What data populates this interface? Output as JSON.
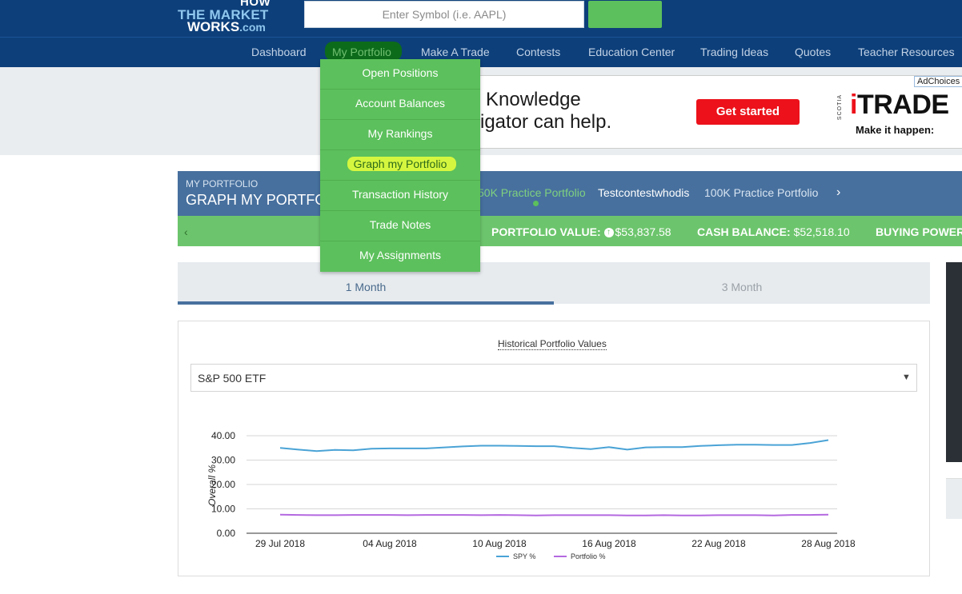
{
  "header": {
    "logo_line1": "HOW",
    "logo_line2": "THE MARKET",
    "logo_line3": "WORKS",
    "logo_line3_suffix": ".com",
    "search_placeholder": "Enter Symbol (i.e. AAPL)",
    "go_label": ""
  },
  "nav": {
    "items": [
      "Dashboard",
      "My Portfolio",
      "Make A Trade",
      "Contests",
      "Education Center",
      "Trading Ideas",
      "Quotes",
      "Teacher Resources"
    ]
  },
  "dropdown": {
    "items": [
      "Open Positions",
      "Account Balances",
      "My Rankings",
      "Graph my Portfolio",
      "Transaction History",
      "Trade Notes",
      "My Assignments"
    ]
  },
  "ad": {
    "line1": "Knowledge",
    "line2": "igator can help.",
    "cta": "Get started",
    "adchoices": "AdChoices",
    "brand_i": "i",
    "brand_rest": "TRADE",
    "brand_vertical": "SCOTIA",
    "tagline": "Make it happen:"
  },
  "portfolio": {
    "kicker": "MY PORTFOLIO",
    "title": "GRAPH MY PORTFOLIO",
    "tabs": [
      "50K Practice Portfolio",
      "Testcontestwhodis",
      "100K Practice Portfolio"
    ],
    "next_icon": "chevron-right-icon",
    "prev_icon": "chevron-left-icon"
  },
  "stats": {
    "portfolio_value_label": "PORTFOLIO VALUE:",
    "portfolio_value": "$53,837.58",
    "cash_balance_label": "CASH BALANCE:",
    "cash_balance": "$52,518.10",
    "buying_power_label": "BUYING POWER:"
  },
  "range_tabs": {
    "one_month": "1 Month",
    "three_month": "3 Month"
  },
  "chart_panel": {
    "title": "Historical Portfolio Values",
    "compare_selected": "S&P 500 ETF"
  },
  "colors": {
    "header_navy": "#0d3f7a",
    "accent_green": "#5cc05c",
    "portfolio_blue": "#47709e",
    "spy_line": "#4aa3d6",
    "portfolio_line": "#b469e0"
  },
  "chart_data": {
    "type": "line",
    "title": "",
    "xlabel": "",
    "ylabel": "Overall %",
    "ylim": [
      0,
      40
    ],
    "yticks": [
      "40.00",
      "30.00",
      "20.00",
      "10.00",
      "0.00"
    ],
    "x_tick_labels": [
      "29 Jul 2018",
      "04 Aug 2018",
      "10 Aug 2018",
      "16 Aug 2018",
      "22 Aug 2018",
      "28 Aug 2018"
    ],
    "x": [
      "29 Jul 2018",
      "30 Jul 2018",
      "31 Jul 2018",
      "01 Aug 2018",
      "02 Aug 2018",
      "03 Aug 2018",
      "04 Aug 2018",
      "05 Aug 2018",
      "06 Aug 2018",
      "07 Aug 2018",
      "08 Aug 2018",
      "09 Aug 2018",
      "10 Aug 2018",
      "11 Aug 2018",
      "12 Aug 2018",
      "13 Aug 2018",
      "14 Aug 2018",
      "15 Aug 2018",
      "16 Aug 2018",
      "17 Aug 2018",
      "18 Aug 2018",
      "19 Aug 2018",
      "20 Aug 2018",
      "21 Aug 2018",
      "22 Aug 2018",
      "23 Aug 2018",
      "24 Aug 2018",
      "25 Aug 2018",
      "26 Aug 2018",
      "27 Aug 2018",
      "28 Aug 2018"
    ],
    "series": [
      {
        "name": "SPY %",
        "color": "#4aa3d6",
        "values": [
          35.0,
          34.3,
          33.7,
          34.2,
          34.0,
          34.7,
          34.8,
          34.8,
          34.8,
          35.2,
          35.6,
          35.9,
          35.9,
          35.8,
          35.7,
          35.7,
          35.0,
          34.5,
          35.3,
          34.3,
          35.2,
          35.3,
          35.3,
          35.8,
          36.1,
          36.3,
          36.3,
          36.2,
          36.2,
          37.0,
          38.2
        ]
      },
      {
        "name": "Portfolio %",
        "color": "#b469e0",
        "values": [
          7.6,
          7.5,
          7.4,
          7.4,
          7.5,
          7.5,
          7.5,
          7.4,
          7.5,
          7.5,
          7.5,
          7.4,
          7.5,
          7.4,
          7.3,
          7.4,
          7.4,
          7.4,
          7.4,
          7.3,
          7.3,
          7.4,
          7.3,
          7.3,
          7.4,
          7.4,
          7.4,
          7.3,
          7.5,
          7.5,
          7.6
        ]
      }
    ],
    "legend": "bottom-center",
    "grid": true
  }
}
